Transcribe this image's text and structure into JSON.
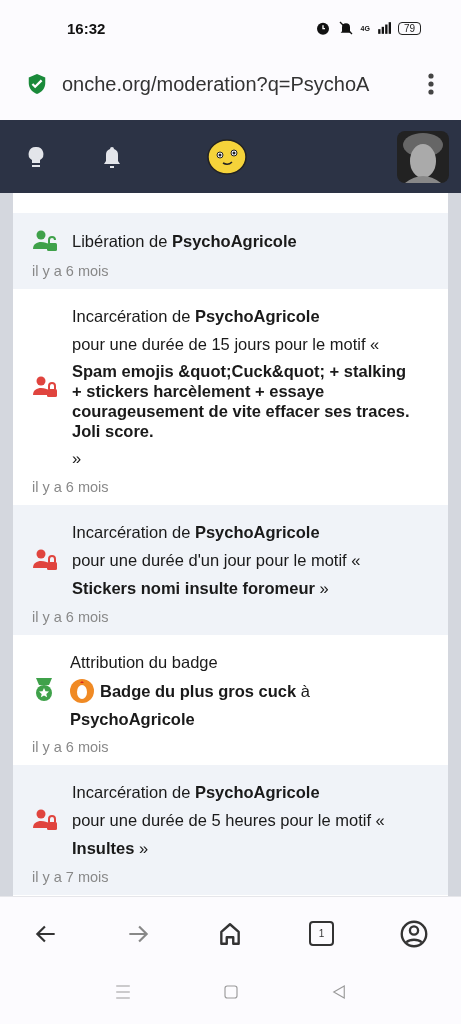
{
  "status_bar": {
    "time": "16:32",
    "network": "4G",
    "battery": "79"
  },
  "address_bar": {
    "url": "onche.org/moderation?q=PsychoA"
  },
  "entries": [
    {
      "kind": "release",
      "shaded": true,
      "lines": [
        {
          "kind": "text",
          "text": "Libération de **PsychoAgricole**",
          "bold": false
        }
      ],
      "time": "il y a 6 mois"
    },
    {
      "kind": "jail",
      "shaded": false,
      "lines": [
        {
          "kind": "text",
          "text": "Incarcération de **PsychoAgricole**",
          "bold": false
        },
        {
          "kind": "text",
          "text": "pour une durée de 15 jours pour le motif «",
          "bold": false
        },
        {
          "kind": "text",
          "text": "Spam emojis &quot;Cuck&quot; + stalking + stickers harcèlement + essaye courageusement de vite effacer ses traces. Joli score.",
          "bold": true
        },
        {
          "kind": "text",
          "text": "»",
          "bold": false
        }
      ],
      "time": "il y a 6 mois"
    },
    {
      "kind": "jail",
      "shaded": true,
      "lines": [
        {
          "kind": "text",
          "text": "Incarcération de **PsychoAgricole**",
          "bold": false
        },
        {
          "kind": "text",
          "text": "pour une durée d'un jour pour le motif «",
          "bold": false
        },
        {
          "kind": "text",
          "text": "**Stickers nomi insulte foromeur** »",
          "bold": false
        }
      ],
      "time": "il y a 6 mois"
    },
    {
      "kind": "badge",
      "shaded": false,
      "lines": [
        {
          "kind": "text",
          "text": "Attribution du badge",
          "bold": false
        },
        {
          "kind": "badge",
          "text": "**Badge du plus gros cuck** à",
          "bold": false
        },
        {
          "kind": "text",
          "text": "PsychoAgricole",
          "bold": true
        }
      ],
      "time": "il y a 6 mois"
    },
    {
      "kind": "jail",
      "shaded": true,
      "lines": [
        {
          "kind": "text",
          "text": "Incarcération de **PsychoAgricole**",
          "bold": false
        },
        {
          "kind": "text",
          "text": "pour une durée de 5 heures pour le motif «",
          "bold": false
        },
        {
          "kind": "text",
          "text": "**Insultes** »",
          "bold": false
        }
      ],
      "time": "il y a 7 mois"
    }
  ],
  "bottom_nav": {
    "tab_count": "1"
  }
}
